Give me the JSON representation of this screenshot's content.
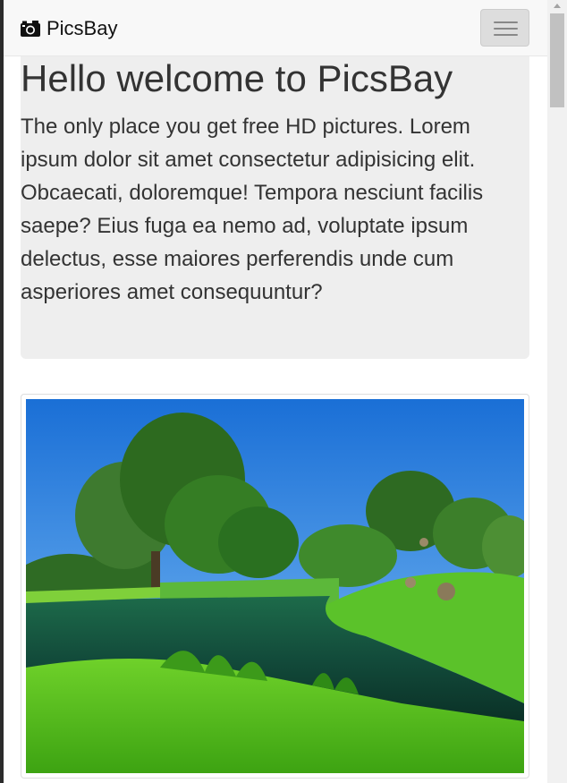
{
  "navbar": {
    "brand": "PicsBay",
    "brand_icon": "camera-icon",
    "toggle_icon": "hamburger-menu-icon"
  },
  "jumbotron": {
    "heading": "Hello welcome to PicsBay",
    "text": "The only place you get free HD pictures. Lorem ipsum dolor sit amet consectetur adipisicing elit. Obcaecati, doloremque! Tempora nesciunt facilis saepe? Eius fuga ea nemo ad, voluptate ipsum delectus, esse maiores perferendis unde cum asperiores amet consequuntur?"
  },
  "gallery": {
    "image_subject": "landscape-photo-pond-trees"
  },
  "colors": {
    "navbar_bg": "#f8f8f8",
    "jumbotron_bg": "#eeeeee",
    "text": "#333333",
    "toggle_bg": "#dddddd"
  }
}
